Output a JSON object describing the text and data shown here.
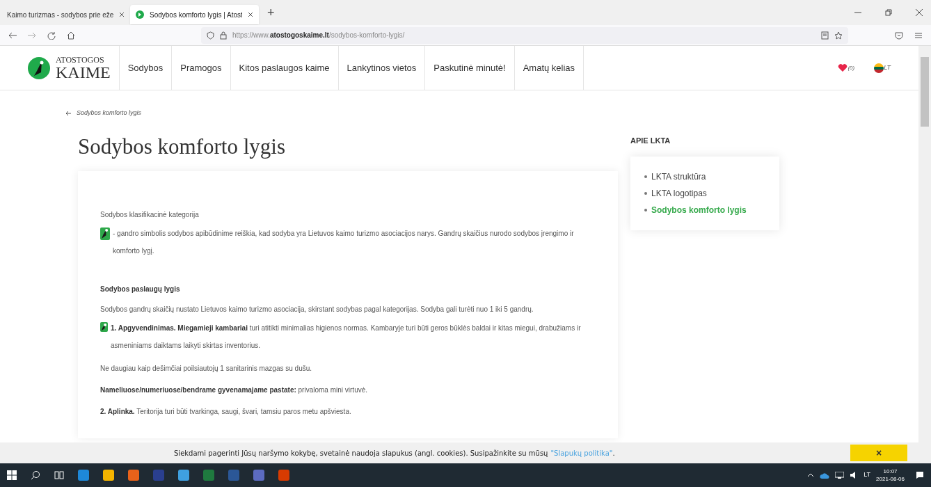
{
  "browser": {
    "tabs": [
      {
        "title": "Kaimo turizmas - sodybos prie eže",
        "selected": false
      },
      {
        "title": "Sodybos komforto lygis | Atost",
        "selected": true
      }
    ],
    "new_tab": "+",
    "address": "https://www.**atostogoskaime.lt**/sodybos-komforto-lygis/"
  },
  "site": {
    "logo_top": "ATOSTOGOS",
    "logo_bottom": "KAIME",
    "nav": [
      "Sodybos",
      "Pramogos",
      "Kitos paslaugos kaime",
      "Lankytinos vietos",
      "Paskutinė minutė!",
      "Amatų kelias"
    ],
    "favorites_count": "(0)",
    "language": "LT"
  },
  "breadcrumb": "Sodybos komforto lygis",
  "title": "Sodybos komforto lygis",
  "content": [
    {
      "kind": "text",
      "text": "Sodybos klasifikacinė kategorija"
    },
    {
      "kind": "stork",
      "text": "- gandro simbolis sodybos apibūdinime reiškia, kad sodyba yra Lietuvos kaimo turizmo asociacijos narys. Gandrų skaičius nurodo sodybos įrengimo ir komforto lygį."
    },
    {
      "kind": "heading",
      "text": "Sodybos paslaugų lygis"
    },
    {
      "kind": "text",
      "text": "Sodybos gandrų skaičių nustato Lietuvos kaimo turizmo asociacija, skirstant sodybas pagal kategorijas. Sodyba gali turėti nuo 1 iki 5 gandrų."
    },
    {
      "kind": "stork",
      "text": "**1. Apgyvendinimas. Miegamieji kambariai** turi atitikti minimalias higienos normas. Kambaryje turi būti geros būklės baldai ir kitas miegui, drabužiams ir asmeniniams daiktams laikyti skirtas inventorius."
    },
    {
      "kind": "text",
      "text": "Ne daugiau kaip dešimčiai poilsiautojų 1 sanitarinis mazgas su dušu."
    },
    {
      "kind": "text",
      "text": "**Nameliuose/numeriuose/bendrame gyvenamajame pastate:** privaloma mini virtuvė."
    },
    {
      "kind": "text",
      "text": "**2. Aplinka.** Teritorija turi būti tvarkinga, saugi, švari, tamsiu paros metu apšviesta."
    }
  ],
  "sidebar": {
    "heading": "APIE LKTA",
    "items": [
      {
        "label": "LKTA struktūra",
        "selected": false
      },
      {
        "label": "LKTA logotipas",
        "selected": false
      },
      {
        "label": "Sodybos komforto lygis",
        "selected": true
      }
    ]
  },
  "cookie_bar": {
    "text": "Siekdami pagerinti Jūsų naršymo kokybę, svetainė naudoja slapukus (angl. cookies). Susipažinkite su mūsų",
    "link": "\"Slapukų politika\"",
    "suffix": ".",
    "close": "×"
  },
  "taskbar": {
    "language": "LT",
    "time": "10:07",
    "date": "2021-08-06"
  }
}
